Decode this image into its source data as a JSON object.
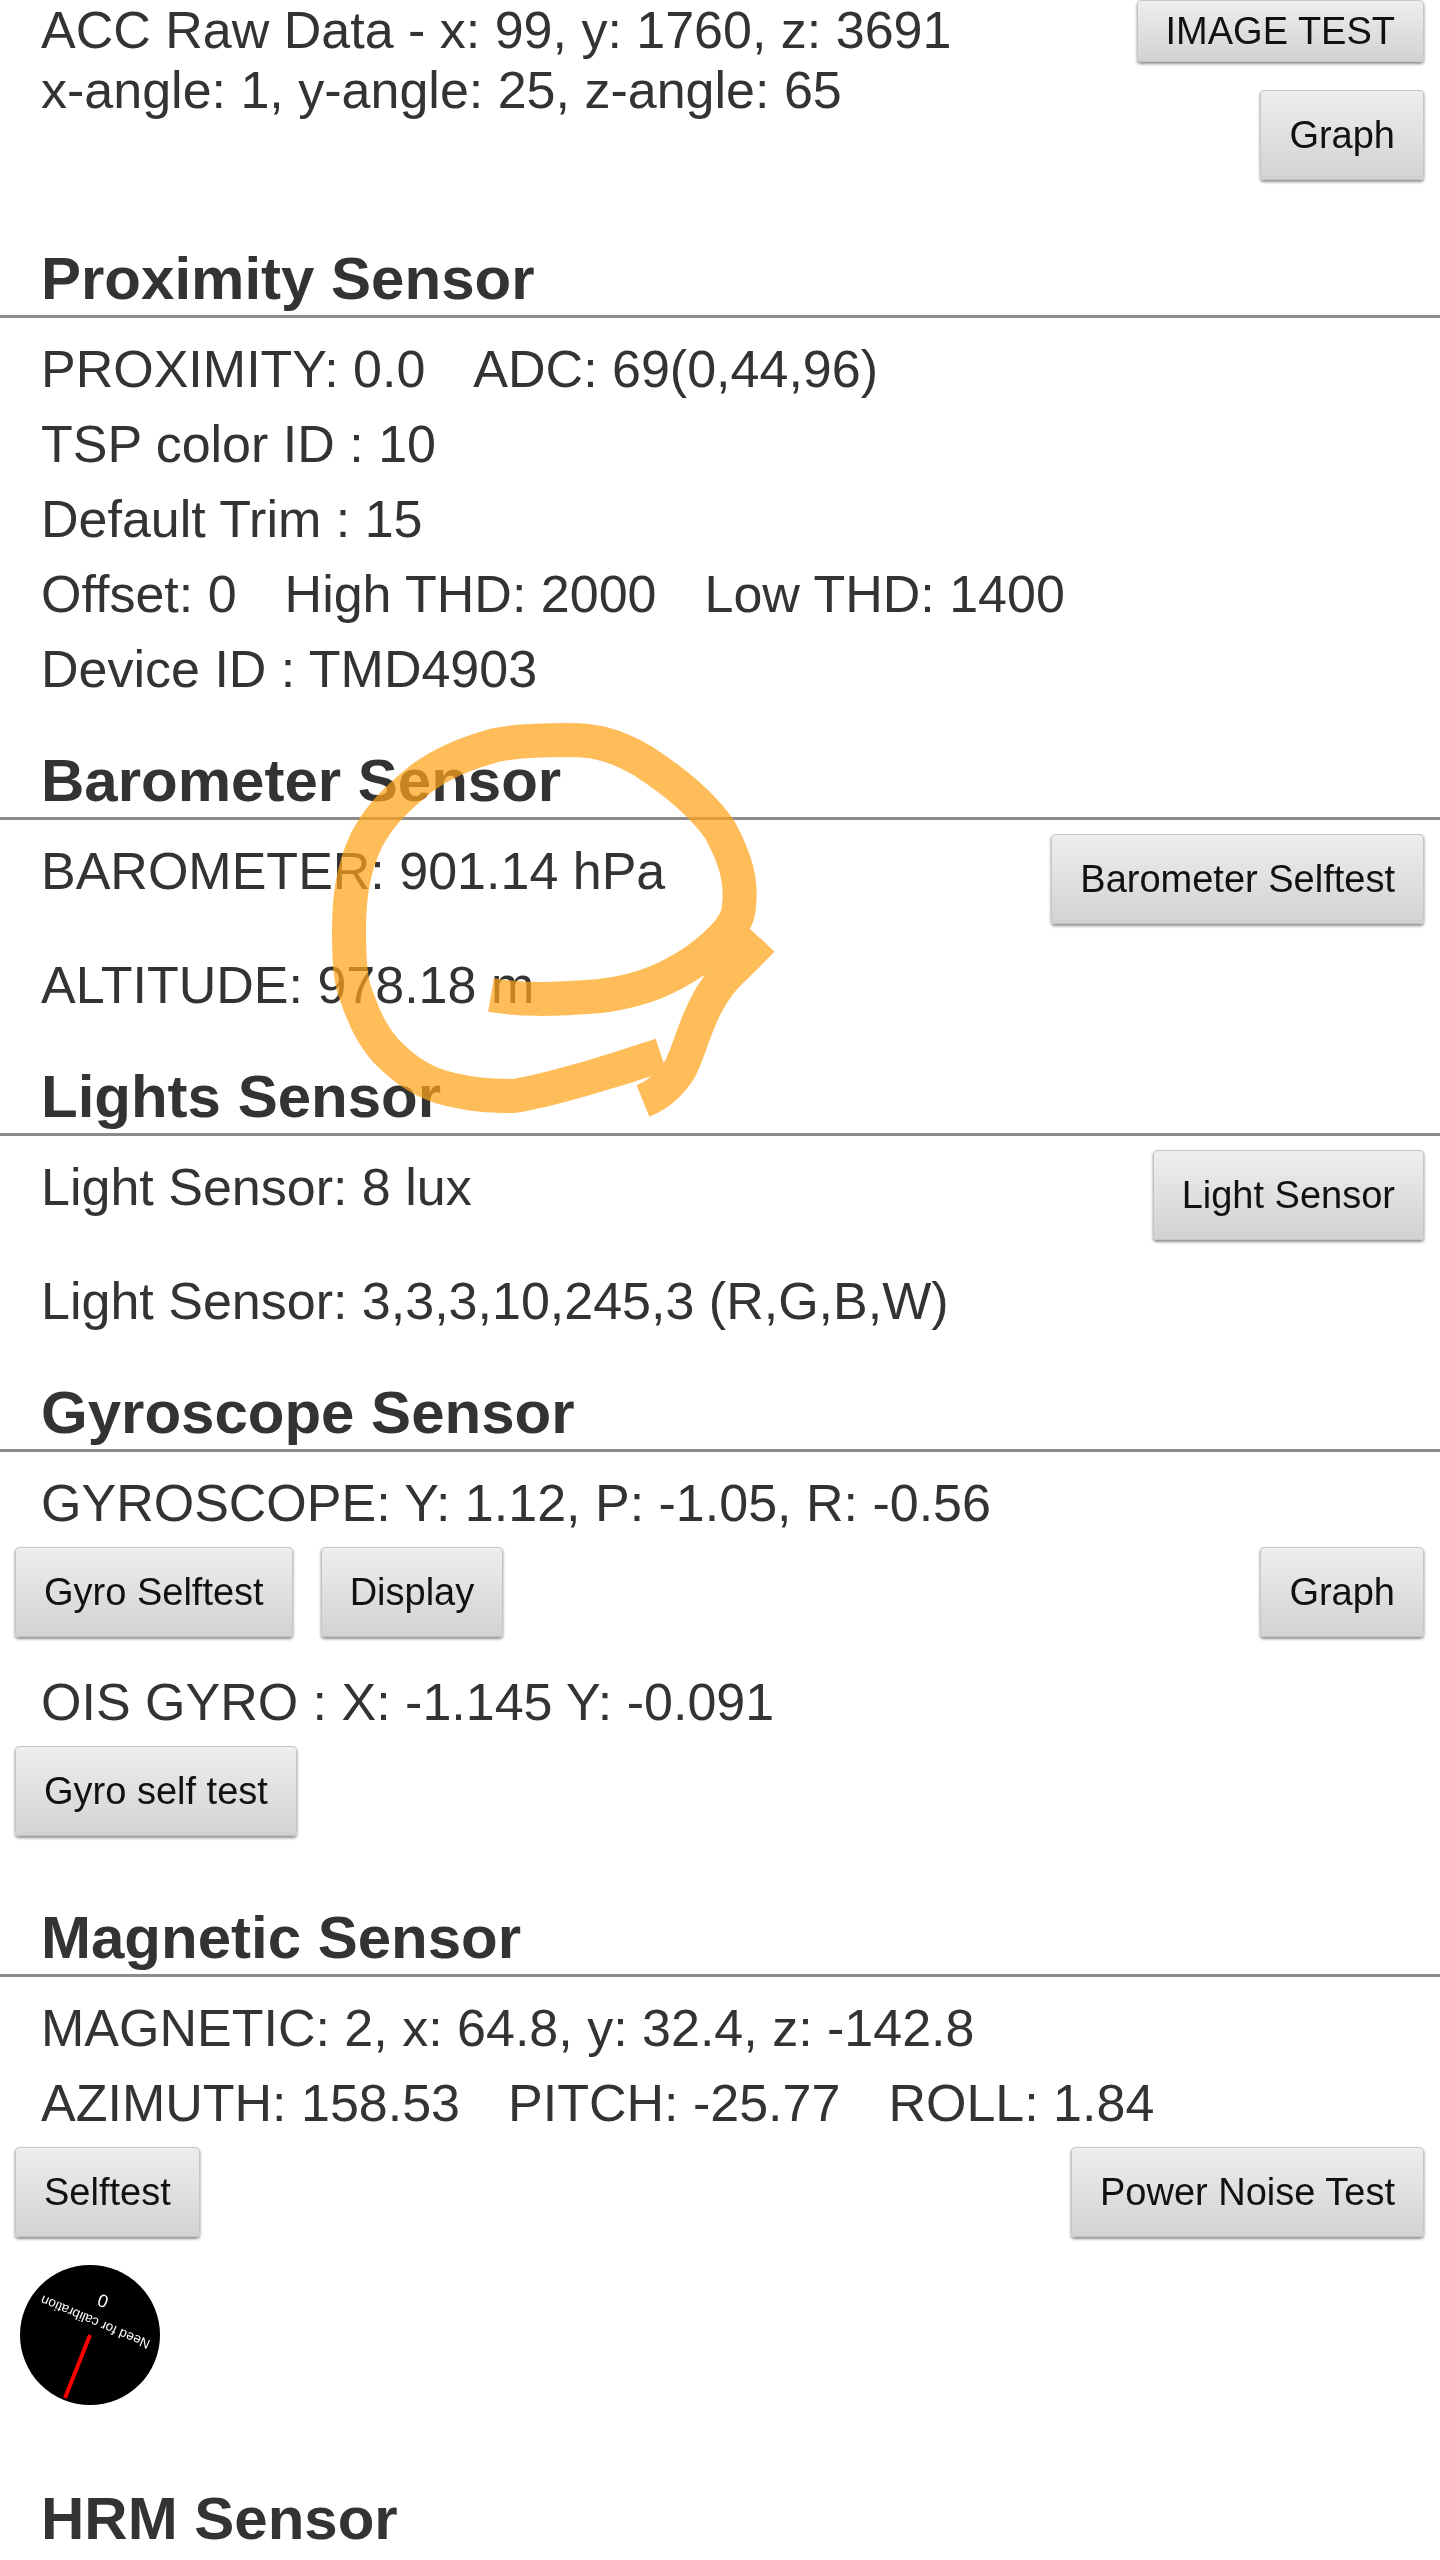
{
  "header": {
    "lines": [
      "ACC Raw Data - x: 99, y: 1760, z: 3691",
      "x-angle: 1, y-angle: 25, z-angle: 65"
    ],
    "buttons": [
      "IMAGE TEST",
      "Graph"
    ]
  },
  "sections": [
    {
      "title": "Proximity Sensor",
      "items": [
        {
          "kind": "line",
          "segments": [
            "PROXIMITY: 0.0",
            "ADC: 69(0,44,96)"
          ]
        },
        {
          "kind": "line",
          "segments": [
            "TSP color ID : 10"
          ]
        },
        {
          "kind": "line",
          "segments": [
            "Default Trim : 15"
          ]
        },
        {
          "kind": "line",
          "segments": [
            "Offset: 0",
            "High THD: 2000",
            "Low THD: 1400"
          ]
        },
        {
          "kind": "line",
          "segments": [
            "Device ID : TMD4903"
          ]
        }
      ]
    },
    {
      "title": "Barometer Sensor",
      "items": [
        {
          "kind": "line",
          "segments": [
            "BAROMETER: 901.14 hPa"
          ],
          "button": "Barometer Selftest"
        },
        {
          "kind": "line",
          "segments": [
            "ALTITUDE: 978.18 m"
          ]
        }
      ]
    },
    {
      "title": "Lights Sensor",
      "items": [
        {
          "kind": "line",
          "segments": [
            "Light Sensor: 8 lux"
          ],
          "button": "Light Sensor"
        },
        {
          "kind": "line",
          "segments": [
            "Light Sensor: 3,3,3,10,245,3 (R,G,B,W)"
          ]
        }
      ]
    },
    {
      "title": "Gyroscope Sensor",
      "items": [
        {
          "kind": "line",
          "segments": [
            "GYROSCOPE: Y: 1.12, P: -1.05, R: -0.56"
          ]
        },
        {
          "kind": "buttons",
          "left": [
            "Gyro Selftest",
            "Display"
          ],
          "right": [
            "Graph"
          ]
        },
        {
          "kind": "line",
          "segments": [
            "OIS GYRO : X: -1.145 Y: -0.091"
          ]
        },
        {
          "kind": "buttons",
          "left": [
            "Gyro self test"
          ]
        }
      ]
    },
    {
      "title": "Magnetic Sensor",
      "items": [
        {
          "kind": "line",
          "segments": [
            "MAGNETIC: 2, x: 64.8, y: 32.4, z: -142.8"
          ]
        },
        {
          "kind": "line",
          "segments": [
            "AZIMUTH: 158.53",
            "PITCH: -25.77",
            "ROLL: 1.84"
          ]
        },
        {
          "kind": "buttons",
          "left": [
            "Selftest"
          ],
          "right": [
            "Power Noise Test"
          ]
        },
        {
          "kind": "compass",
          "reading": "0",
          "message": "Need for calibration"
        }
      ]
    },
    {
      "title": "HRM Sensor"
    }
  ]
}
